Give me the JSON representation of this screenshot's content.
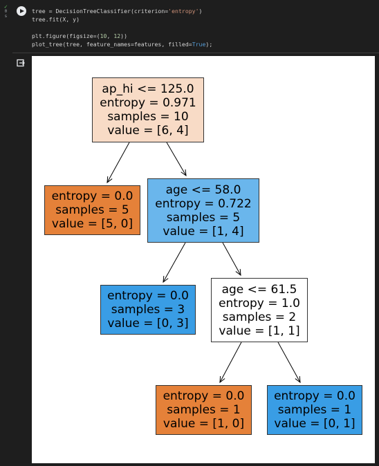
{
  "cell": {
    "gutter_mini_top": "✓",
    "gutter_mini_mid": "0",
    "gutter_mini_bot": "s",
    "code": [
      [
        {
          "t": "tree = DecisionTreeClassifier(criterion="
        },
        {
          "t": "'entropy'",
          "c": "str"
        },
        {
          "t": ")"
        }
      ],
      [
        {
          "t": "tree.fit(X, y)"
        }
      ],
      [],
      [
        {
          "t": "plt.figure(figsize=("
        },
        {
          "t": "10",
          "c": "num"
        },
        {
          "t": ", "
        },
        {
          "t": "12",
          "c": "num"
        },
        {
          "t": "))"
        }
      ],
      [
        {
          "t": "plot_tree(tree, feature_names=features, filled="
        },
        {
          "t": "True",
          "c": "kw"
        },
        {
          "t": ");"
        }
      ]
    ]
  },
  "tree": {
    "nodes": {
      "root": {
        "lines": [
          "ap_hi <= 125.0",
          "entropy = 0.971",
          "samples = 10",
          "value = [6, 4]"
        ],
        "fill": "#f8dbc6"
      },
      "n1": {
        "lines": [
          "entropy = 0.0",
          "samples = 5",
          "value = [5, 0]"
        ],
        "fill": "#e58139"
      },
      "n2": {
        "lines": [
          "age <= 58.0",
          "entropy = 0.722",
          "samples = 5",
          "value = [1, 4]"
        ],
        "fill": "#6ab6ec"
      },
      "n3": {
        "lines": [
          "entropy = 0.0",
          "samples = 3",
          "value = [0, 3]"
        ],
        "fill": "#399de5"
      },
      "n4": {
        "lines": [
          "age <= 61.5",
          "entropy = 1.0",
          "samples = 2",
          "value = [1, 1]"
        ],
        "fill": "#ffffff"
      },
      "n5": {
        "lines": [
          "entropy = 0.0",
          "samples = 1",
          "value = [1, 0]"
        ],
        "fill": "#e58139"
      },
      "n6": {
        "lines": [
          "entropy = 0.0",
          "samples = 1",
          "value = [0, 1]"
        ],
        "fill": "#399de5"
      }
    }
  }
}
